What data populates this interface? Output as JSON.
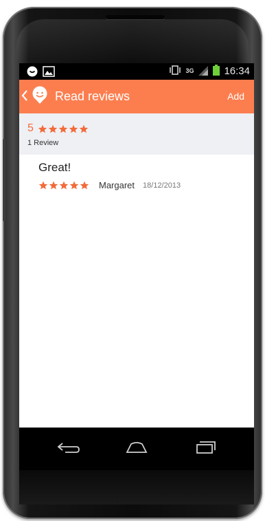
{
  "status_bar": {
    "network_label": "3G",
    "time": "16:34"
  },
  "app_bar": {
    "title": "Read reviews",
    "add_label": "Add",
    "accent_color": "#fc7e4f"
  },
  "summary": {
    "average": "5",
    "stars": 5,
    "count_label": "1 Review"
  },
  "reviews": [
    {
      "title": "Great!",
      "stars": 5,
      "author": "Margaret",
      "date": "18/12/2013"
    }
  ],
  "colors": {
    "star": "#f26b3a",
    "summary_bg": "#eff0f4"
  },
  "icons": [
    "notification-icon",
    "image-icon",
    "vibrate-icon",
    "signal-icon",
    "battery-icon",
    "back-chevron-icon",
    "app-logo-icon",
    "star-icon",
    "back-nav-icon",
    "home-nav-icon",
    "recents-nav-icon"
  ]
}
